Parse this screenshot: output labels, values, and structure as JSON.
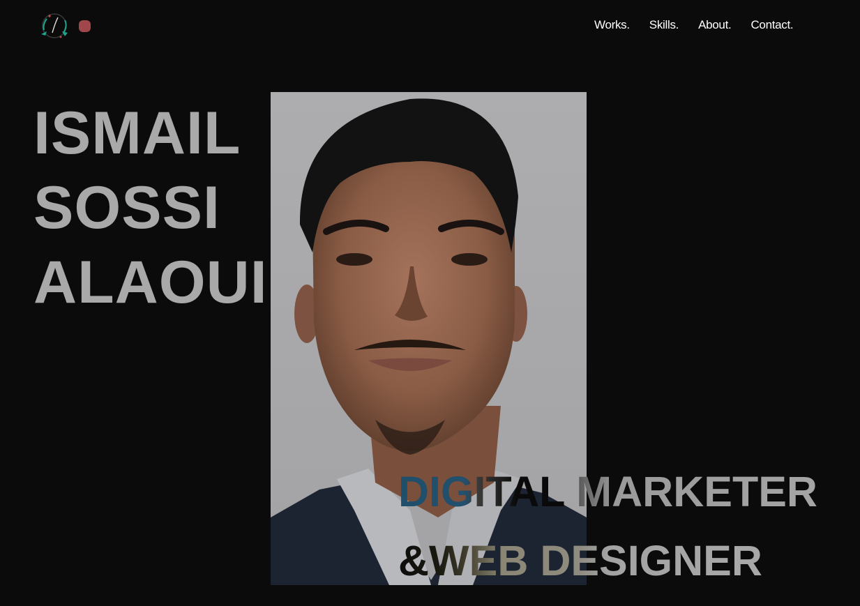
{
  "header": {
    "logo_icon": "signature-monogram-logo",
    "status_dot_color": "#a0474b",
    "nav": [
      {
        "label": "Works."
      },
      {
        "label": "Skills."
      },
      {
        "label": "About."
      },
      {
        "label": "Contact."
      }
    ]
  },
  "hero": {
    "name_lines": [
      "ISMAIL",
      "SOSSI",
      "ALAOUI"
    ],
    "tagline_lines": [
      "DIGITAL MARKETER",
      "&WEB DESIGNER"
    ]
  },
  "colors": {
    "background": "#0b0b0b",
    "name_text": "#a9a9a9",
    "nav_text": "#ffffff",
    "tagline_accent": "#1f4f6a"
  }
}
